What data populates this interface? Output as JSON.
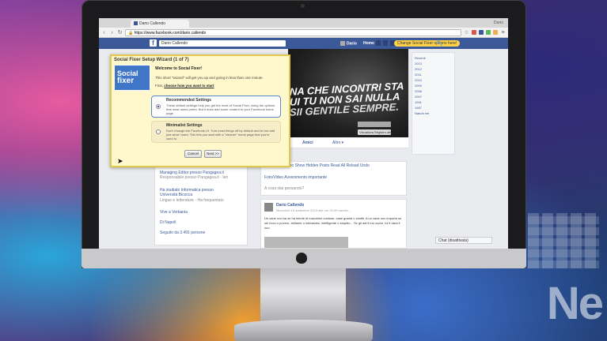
{
  "browser": {
    "tab_title": "Dario Callendo",
    "window_user": "Dario",
    "url": "https://www.facebook.com/dario.callendo"
  },
  "facebook": {
    "search_value": "Dario Callendo",
    "user_name": "Dario",
    "home_label": "Home",
    "sfx_badge": "Change Social Fixer options here!"
  },
  "wizard": {
    "title": "Social Fixer Setup Wizard (1 of 7)",
    "logo_line1": "Social",
    "logo_line2": "fixer",
    "welcome": "Welcome to Social Fixer!",
    "intro": "This short \"wizard\" will get you up and going in less than one minute.",
    "first_prefix": "First, ",
    "first_link": "choose how you want to start",
    "recommended": {
      "title": "Recommended Settings",
      "desc": "These default settings help you get the most of Social Fixer, using the options that most users prefer. But it does add some content to your Facebook home page."
    },
    "minimal": {
      "title": "Minimalist Settings",
      "desc": "Don't change the Facebook UI. Turn most things off by default and let me add just what I want. This lets you start with a \"cleaner\" home page that you're used to."
    },
    "cancel_label": "Cancel",
    "next_label": "Next >>"
  },
  "cover": {
    "line1": "NA CHE INCONTRI STA",
    "line2": "UI TU NON SAI NULLA",
    "line3": "SII GENTILE SEMPRE.",
    "button": "Visualizza Registro attività"
  },
  "profile_tabs": {
    "friends": "Amici",
    "more": "Altro ▾"
  },
  "left_panel": {
    "item1": "Managing Editor presso Pangagea.it",
    "item1_sub": "Responsabile presso Pangagea.it - Ieri",
    "item2": "Ha studiato Informatica presso Università Bicocca",
    "item2_sub": "Lingue e letterature - Ha frequentato",
    "item3": "Vive a Verbania",
    "item4": "Di Napoli",
    "item5": "Seguito da 3.491 persone"
  },
  "composer": {
    "row1": "Stato   Foto/Video   Show Hidden Posts   Read All   Reload   Undo",
    "row2": "Foto/Video   Avvenimento importante",
    "row3": "A cosa stai pensando?"
  },
  "post": {
    "author": "Dario Callendo",
    "meta": "Mercoledì 18 settembre 2013 alle ore 20:49 tramite ...",
    "text": "Un cane non sa se ha niente di macchine costose, case grandi o vestiti. A un cane non importa se sei ricco o povero, brillante o imbranato, intelligente o stupido... Se gli dai il tuo cuore, lui ti darà il suo."
  },
  "sidebar": {
    "years": [
      "Recenti",
      "2013",
      "2012",
      "2011",
      "2010",
      "2009",
      "2008",
      "2007",
      "1991",
      "1987",
      "Nato/a nel"
    ],
    "chat": "Chat (disattivata)"
  },
  "colors": {
    "facebook_blue": "#3b5998",
    "wizard_bg": "#fff8cc",
    "wizard_border": "#e3c94a",
    "sfx_badge": "#ffd24a"
  }
}
